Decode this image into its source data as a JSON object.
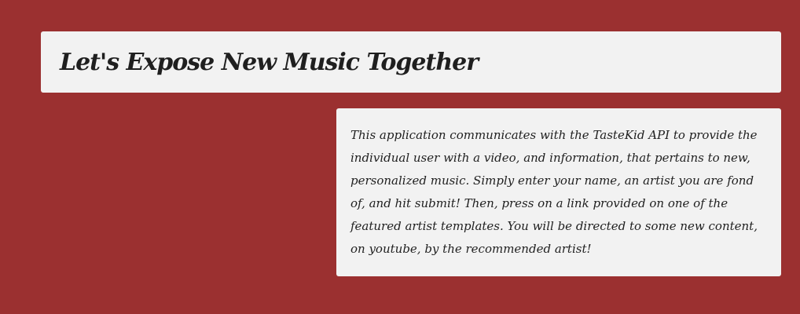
{
  "header": {
    "title": "Let's Expose New Music Together"
  },
  "intro": {
    "text": "This application communicates with the TasteKid API to provide the individual user with a video, and information, that pertains to new, personalized music. Simply enter your name, an artist you are fond of, and hit submit! Then, press on a link provided on one of the featured artist templates. You will be directed to some new content, on youtube, by the recommended artist!"
  },
  "colors": {
    "background": "#9b3030",
    "card": "#f2f2f2",
    "text": "#1f1f1f"
  }
}
